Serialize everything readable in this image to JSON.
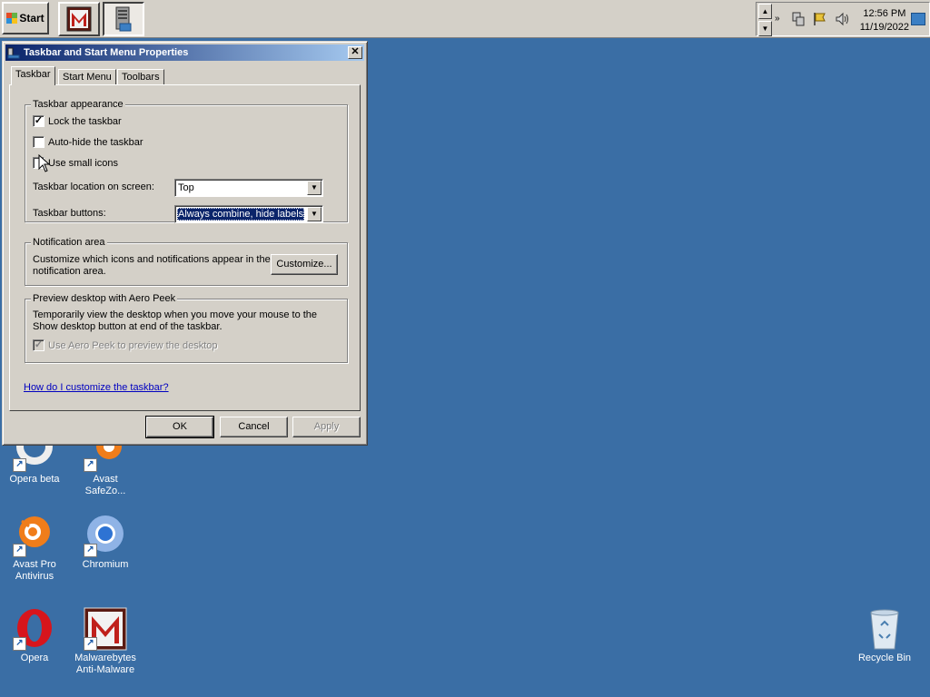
{
  "taskbar": {
    "start_label": "Start",
    "task_buttons": [
      {
        "icon": "malwarebytes-icon",
        "active": false
      },
      {
        "icon": "computer-management-icon",
        "active": true
      }
    ],
    "tray": {
      "icons": [
        "chevron-icon",
        "network-icon",
        "action-center-flag-icon",
        "volume-icon"
      ],
      "time": "12:56 PM",
      "date": "11/19/2022"
    }
  },
  "dialog": {
    "title": "Taskbar and Start Menu Properties",
    "close_label": "✕",
    "tabs": [
      {
        "label": "Taskbar",
        "active": true
      },
      {
        "label": "Start Menu",
        "active": false
      },
      {
        "label": "Toolbars",
        "active": false
      }
    ],
    "appearance": {
      "title": "Taskbar appearance",
      "lock_label": "Lock the taskbar",
      "lock_checked": true,
      "autohide_label": "Auto-hide the taskbar",
      "autohide_checked": false,
      "small_icons_label": "Use small icons",
      "small_icons_checked": false,
      "location_label": "Taskbar location on screen:",
      "location_value": "Top",
      "buttons_label": "Taskbar buttons:",
      "buttons_value": "Always combine, hide labels"
    },
    "notification": {
      "title": "Notification area",
      "text": "Customize which icons and notifications appear in the notification area.",
      "customize_label": "Customize..."
    },
    "peek": {
      "title": "Preview desktop with Aero Peek",
      "text": "Temporarily view the desktop when you move your mouse to the Show desktop button at end of the taskbar.",
      "checkbox_label": "Use Aero Peek to preview the desktop",
      "checkbox_checked": true
    },
    "help_link": "How do I customize the taskbar?",
    "buttons": {
      "ok": "OK",
      "cancel": "Cancel",
      "apply": "Apply"
    }
  },
  "desktop": {
    "icons": [
      {
        "label": "Opera beta",
        "icon": "opera-beta-icon"
      },
      {
        "label": "Avast SafeZo...",
        "icon": "avast-safezone-icon"
      },
      {
        "label": "Avast Pro Antivirus",
        "icon": "avast-icon"
      },
      {
        "label": "Chromium",
        "icon": "chromium-icon"
      },
      {
        "label": "Opera",
        "icon": "opera-icon"
      },
      {
        "label": "Malwarebytes Anti-Malware",
        "icon": "malwarebytes-icon"
      },
      {
        "label": "Recycle Bin",
        "icon": "recycle-bin-icon"
      }
    ]
  },
  "colors": {
    "desktop": "#3a6ea5",
    "title_active": "#0a246a",
    "face": "#d4d0c8"
  }
}
